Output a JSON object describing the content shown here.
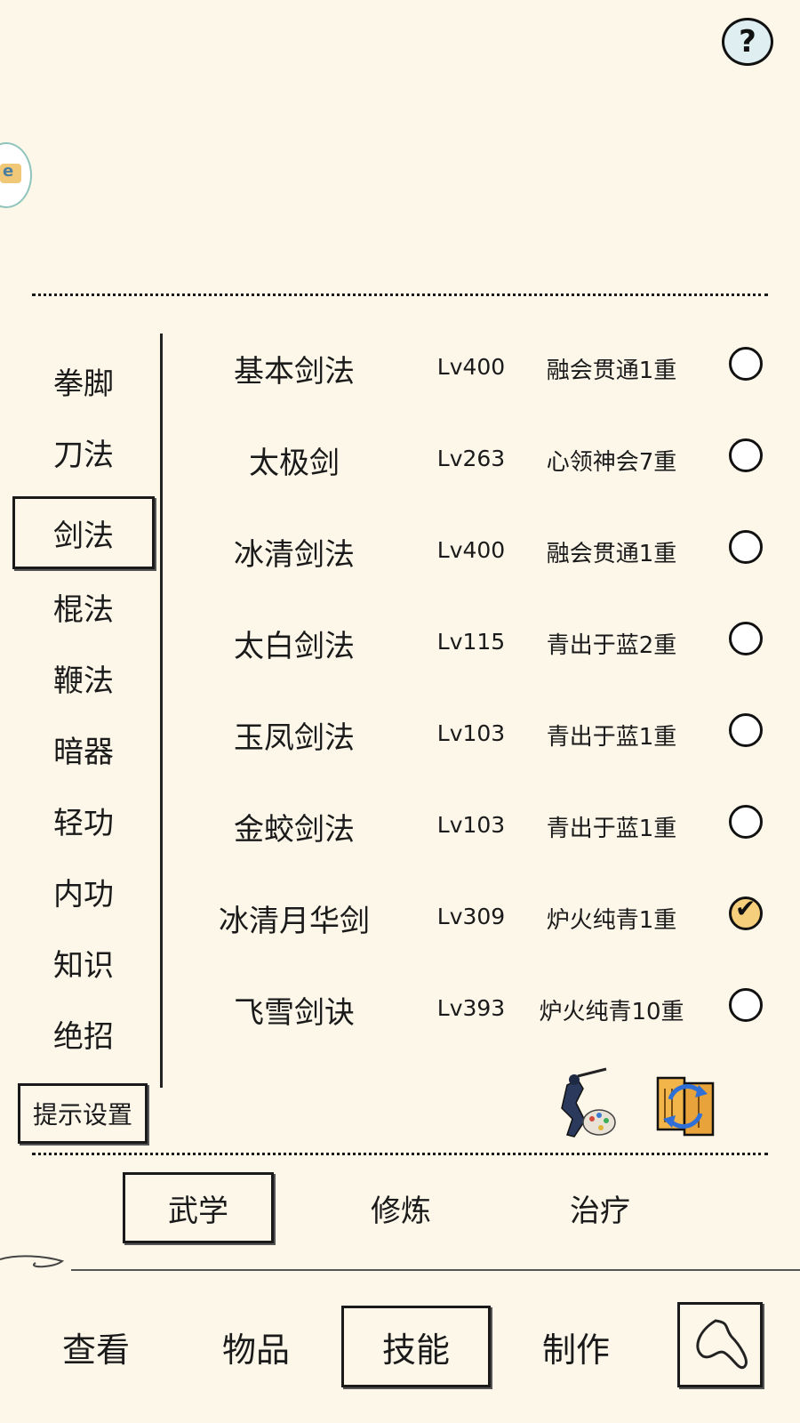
{
  "header": {
    "help_label": "?"
  },
  "categories": [
    "拳脚",
    "刀法",
    "剑法",
    "棍法",
    "鞭法",
    "暗器",
    "轻功",
    "内功",
    "知识",
    "绝招"
  ],
  "active_category": "剑法",
  "hint_settings_label": "提示设置",
  "skills": [
    {
      "name": "基本剑法",
      "level": "Lv400",
      "stage": "融会贯通1重",
      "checked": false
    },
    {
      "name": "太极剑",
      "level": "Lv263",
      "stage": "心领神会7重",
      "checked": false
    },
    {
      "name": "冰清剑法",
      "level": "Lv400",
      "stage": "融会贯通1重",
      "checked": false
    },
    {
      "name": "太白剑法",
      "level": "Lv115",
      "stage": "青出于蓝2重",
      "checked": false
    },
    {
      "name": "玉凤剑法",
      "level": "Lv103",
      "stage": "青出于蓝1重",
      "checked": false
    },
    {
      "name": "金蛟剑法",
      "level": "Lv103",
      "stage": "青出于蓝1重",
      "checked": false
    },
    {
      "name": "冰清月华剑",
      "level": "Lv309",
      "stage": "炉火纯青1重",
      "checked": true
    },
    {
      "name": "飞雪剑诀",
      "level": "Lv393",
      "stage": "炉火纯青10重",
      "checked": false
    }
  ],
  "sub_tabs": [
    "武学",
    "修炼",
    "治疗"
  ],
  "active_sub_tab": "武学",
  "bottom_nav": [
    "查看",
    "物品",
    "技能",
    "制作"
  ],
  "active_bottom_nav": "技能",
  "icons": {
    "help": "question-mark-icon",
    "side_badge": "floating-badge-icon",
    "action_1": "swordsman-palette-icon",
    "action_2": "scroll-swap-icon",
    "back": "back-arrow-icon"
  },
  "colors": {
    "background": "#fdf7ea",
    "check_fill": "#f6cf7c",
    "ink": "#1a1a1a"
  }
}
